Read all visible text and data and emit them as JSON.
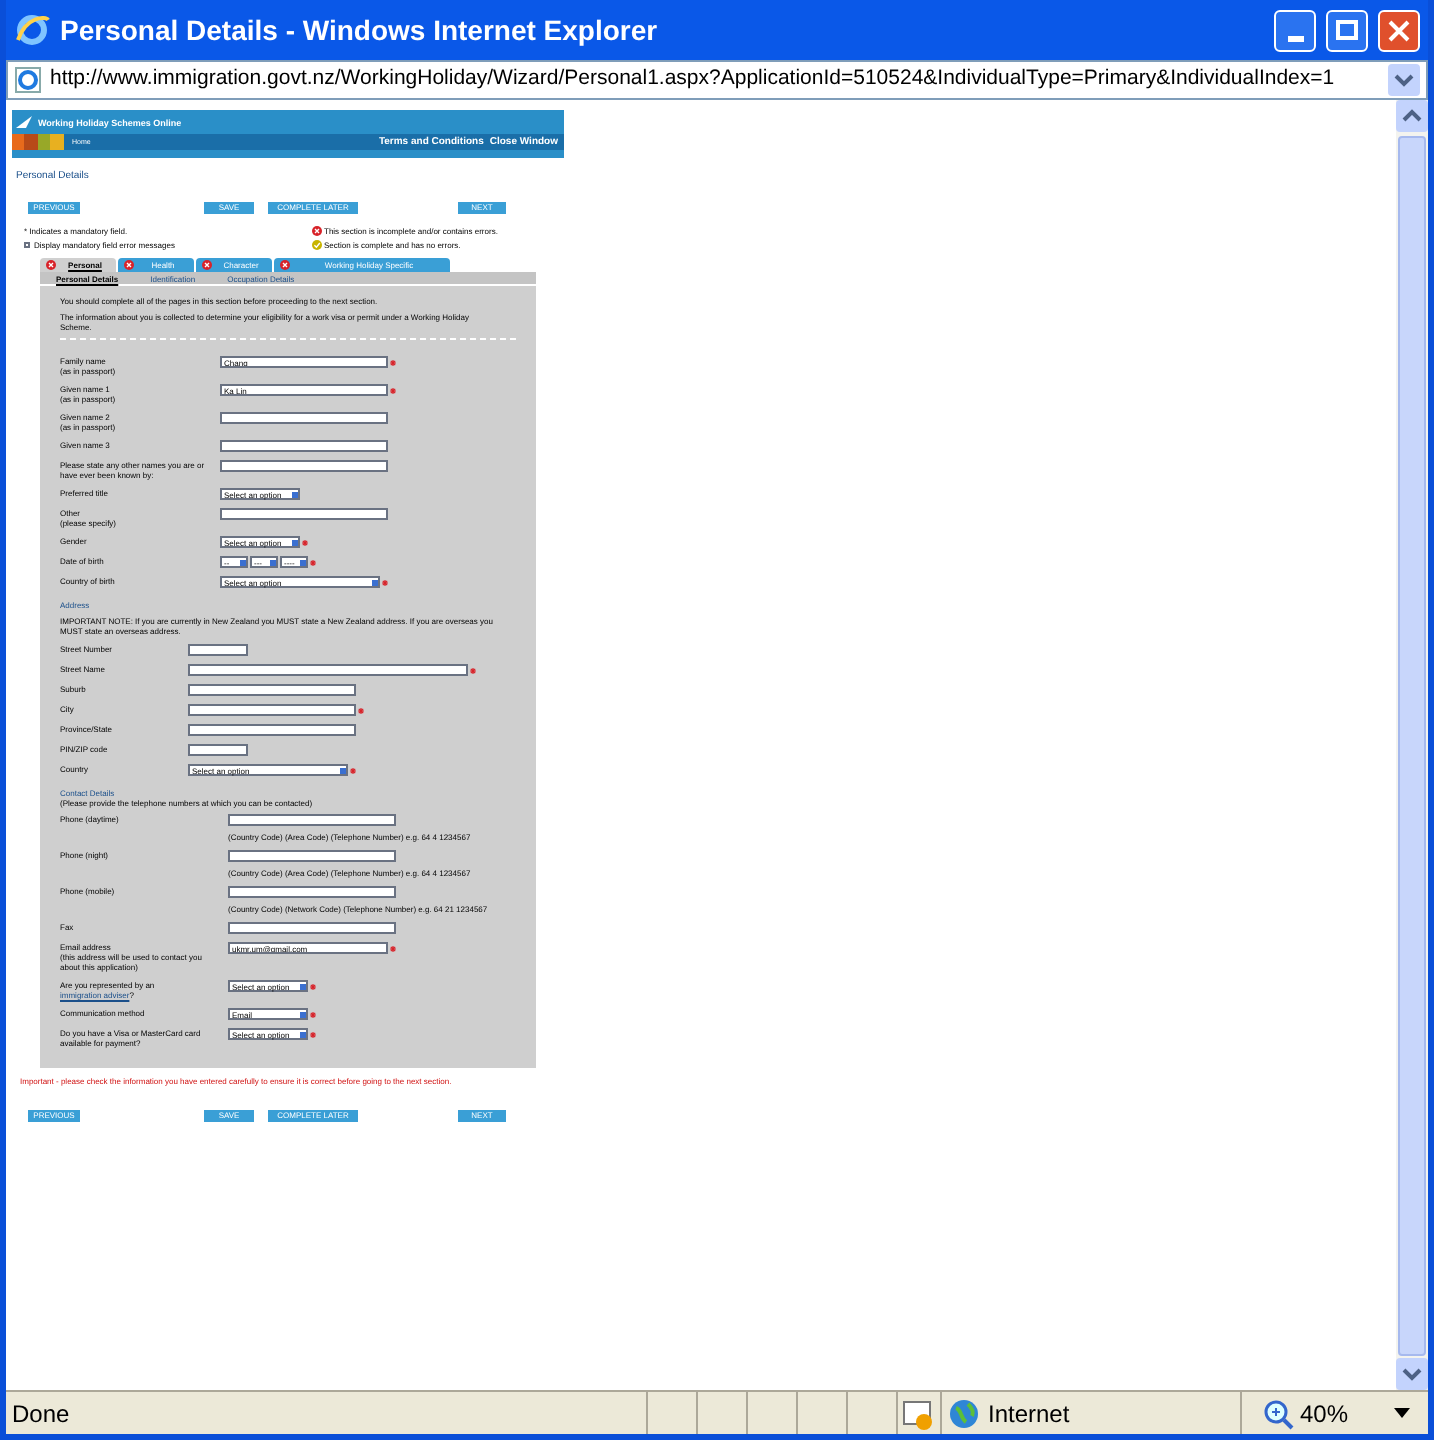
{
  "window": {
    "title": "Personal Details - Windows Internet Explorer"
  },
  "address_bar": {
    "url": "http://www.immigration.govt.nz/WorkingHoliday/Wizard/Personal1.aspx?ApplicationId=510524&IndividualType=Primary&IndividualIndex=1"
  },
  "header": {
    "title": "Working Holiday Schemes Online",
    "home": "Home",
    "links": [
      "Terms and Conditions",
      "Close Window"
    ]
  },
  "heading": "Personal Details",
  "buttons_top": [
    "PREVIOUS",
    "SAVE",
    "COMPLETE LATER",
    "NEXT"
  ],
  "legend": {
    "mandatory_note": "* Indicates a mandatory field.",
    "display_errors": {
      "label": "Display mandatory field error messages",
      "checked": false
    },
    "keys": [
      {
        "kind": "incomplete",
        "label": "This section is incomplete and/or contains errors."
      },
      {
        "kind": "complete",
        "label": "Section is complete and has no errors."
      }
    ]
  },
  "tabs": [
    {
      "label": "Personal",
      "selected": true,
      "complete": false
    },
    {
      "label": "Health",
      "selected": false,
      "complete": false
    },
    {
      "label": "Character",
      "selected": false,
      "complete": false
    },
    {
      "label": "Working Holiday Specific",
      "selected": false,
      "complete": false
    }
  ],
  "subtabs": [
    {
      "label": "Personal Details",
      "selected": true
    },
    {
      "label": "Identification",
      "selected": false
    },
    {
      "label": "Occupation Details",
      "selected": false
    }
  ],
  "intro": [
    "You should complete all of the pages in this section before proceeding to the next section.",
    "The information about you is collected to determine your eligibility for a work visa or permit under a Working Holiday Scheme."
  ],
  "personal_fields": [
    {
      "kind": "text",
      "label": "Family name",
      "note": "(as in passport)",
      "value": "Chang",
      "mandatory": true
    },
    {
      "kind": "text",
      "label": "Given name 1",
      "note": "(as in passport)",
      "value": "Ka Lin",
      "mandatory": true
    },
    {
      "kind": "text",
      "label": "Given name 2",
      "note": "(as in passport)",
      "mandatory": false
    },
    {
      "kind": "text",
      "label": "Given name 3",
      "mandatory": false
    },
    {
      "kind": "text",
      "label": "Please state any other names you are or have ever been known by:",
      "mandatory": false
    },
    {
      "kind": "select",
      "label": "Preferred title",
      "value": "Select an option",
      "mandatory": false
    },
    {
      "kind": "text",
      "label": "Other",
      "note": "(please specify)",
      "mandatory": false
    },
    {
      "kind": "select",
      "label": "Gender",
      "value": "Select an option",
      "mandatory": true
    },
    {
      "kind": "date",
      "label": "Date of birth",
      "parts": [
        "--",
        "---",
        "----"
      ],
      "mandatory": true
    },
    {
      "kind": "wideselect",
      "label": "Country of birth",
      "value": "Select an option",
      "mandatory": true
    }
  ],
  "address": {
    "heading": "Address",
    "note": "IMPORTANT NOTE: If you are currently in New Zealand you MUST state a New Zealand address. If you are overseas you MUST state an overseas address.",
    "fields": [
      {
        "kind": "short",
        "label": "Street Number",
        "mandatory": false
      },
      {
        "kind": "long",
        "label": "Street Name",
        "mandatory": true
      },
      {
        "kind": "text",
        "label": "Suburb",
        "mandatory": false
      },
      {
        "kind": "text",
        "label": "City",
        "mandatory": true
      },
      {
        "kind": "text",
        "label": "Province/State",
        "mandatory": false
      },
      {
        "kind": "short",
        "label": "PIN/ZIP code",
        "mandatory": false
      },
      {
        "kind": "wideselect",
        "label": "Country",
        "value": "Select an option",
        "mandatory": true
      }
    ]
  },
  "contact": {
    "heading": "Contact Details",
    "note": "(Please provide the telephone numbers at which you can be contacted)",
    "fields": [
      {
        "kind": "text",
        "label": "Phone (daytime)",
        "hint": "(Country Code) (Area Code) (Telephone Number) e.g. 64 4 1234567",
        "mandatory": false
      },
      {
        "kind": "text",
        "label": "Phone (night)",
        "hint": "(Country Code) (Area Code) (Telephone Number) e.g. 64 4 1234567",
        "mandatory": false
      },
      {
        "kind": "text",
        "label": "Phone (mobile)",
        "hint": "(Country Code) (Network Code) (Telephone Number) e.g. 64 21 1234567",
        "mandatory": false
      },
      {
        "kind": "text",
        "label": "Fax",
        "mandatory": false
      },
      {
        "kind": "long",
        "label": "Email address",
        "note": "(this address will be used to contact you about this application)",
        "value": "ukmr.um@gmail.com",
        "mandatory": true
      },
      {
        "kind": "select",
        "label": "Are you represented by an",
        "link": "immigration adviser",
        "label_end": "?",
        "value": "Select an option",
        "mandatory": true
      },
      {
        "kind": "select",
        "label": "Communication method",
        "value": "Email",
        "mandatory": true
      },
      {
        "kind": "select",
        "label": "Do you have a Visa or MasterCard card available for payment?",
        "value": "Select an option",
        "mandatory": true
      }
    ]
  },
  "warning": "Important - please check the information you have entered carefully to ensure it is correct before going to the next section.",
  "buttons_bottom": [
    "PREVIOUS",
    "SAVE",
    "COMPLETE LATER",
    "NEXT"
  ],
  "status_bar": {
    "text": "Done",
    "zone": "Internet",
    "zoom": "40%"
  }
}
